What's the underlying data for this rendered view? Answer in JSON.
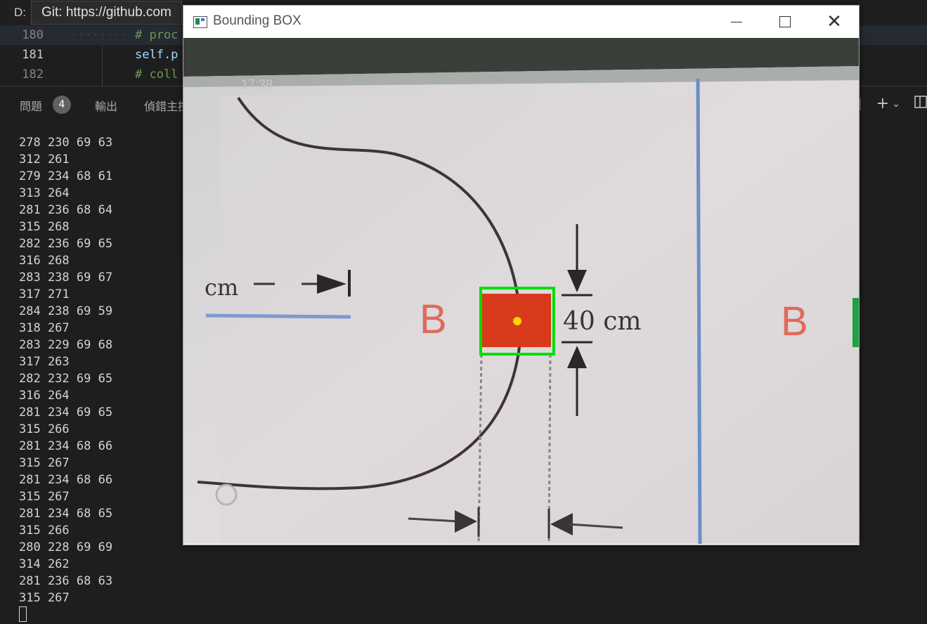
{
  "titlebar": {
    "drive_label": "D:",
    "tooltip": "Git: https://github.com"
  },
  "editor": {
    "lines": [
      {
        "num": "180",
        "text": "# proc"
      },
      {
        "num": "181",
        "text": "self.p"
      },
      {
        "num": "182",
        "text": "# coll"
      }
    ]
  },
  "panel": {
    "tabs": [
      {
        "label": "問題"
      },
      {
        "label": "輸出"
      },
      {
        "label": "偵錯主控"
      }
    ],
    "problems_count": "4",
    "terminal_lines": [
      "278 230 69 63",
      "312 261",
      "279 234 68 61",
      "313 264",
      "281 236 68 64",
      "315 268",
      "282 236 69 65",
      "316 268",
      "283 238 69 67",
      "317 271",
      "284 238 69 59",
      "318 267",
      "283 229 69 68",
      "317 263",
      "282 232 69 65",
      "316 264",
      "281 234 69 65",
      "315 266",
      "281 234 68 66",
      "315 267",
      "281 234 68 66",
      "315 267",
      "281 234 68 65",
      "315 266",
      "280 228 69 69",
      "314 262",
      "281 236 68 63",
      "315 267"
    ]
  },
  "cv_window": {
    "title": "Bounding BOX",
    "image": {
      "left_letter": "B",
      "right_letter": "B",
      "left_dim_text": "cm",
      "dim_text": "40 cm",
      "clock_text": "17:38"
    }
  },
  "colors": {
    "bbox": "#00e000",
    "red_block": "#d83a1c",
    "center_dot": "#ffd400",
    "letter_b": "#e06a5a"
  }
}
